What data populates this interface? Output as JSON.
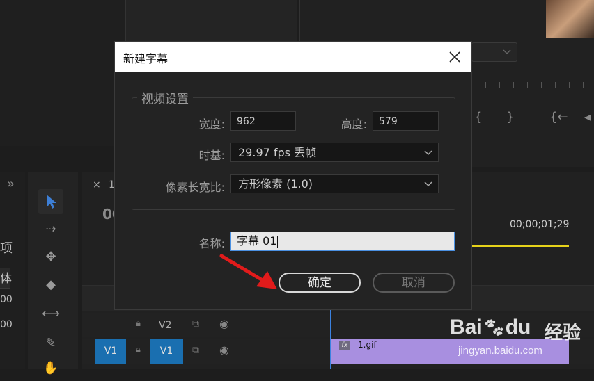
{
  "dialog": {
    "title": "新建字幕",
    "group_title": "视频设置",
    "width_label": "宽度:",
    "width_value": "962",
    "height_label": "高度:",
    "height_value": "579",
    "timebase_label": "时基:",
    "timebase_value": "29.97 fps 丢帧",
    "pixel_aspect_label": "像素长宽比:",
    "pixel_aspect_value": "方形像素 (1.0)",
    "name_label": "名称:",
    "name_value": "字幕 01",
    "ok_label": "确定",
    "cancel_label": "取消"
  },
  "background": {
    "timecode_left": "00",
    "timecode_right": "00;00;01;29",
    "tab_close": "×",
    "tab_num": "1",
    "panel_expand": "»",
    "left_text_1": "项",
    "left_text_2": "体",
    "left_text_3": "00",
    "left_text_4": "00",
    "track_v2": "V2",
    "track_v1_a": "V1",
    "track_v1_b": "V1",
    "clip_fx": "fx",
    "clip_name": "1.gif"
  },
  "watermark": {
    "brand": "Bai",
    "brand2": "du",
    "brand_cn": "经验",
    "url": "jingyan.baidu.com"
  },
  "colors": {
    "accent_blue": "#4a90e2",
    "clip_purple": "#a88fe0",
    "track_blue": "#1a6fb0",
    "playhead_yellow": "#e6d21a",
    "arrow_red": "#e11b1b"
  }
}
